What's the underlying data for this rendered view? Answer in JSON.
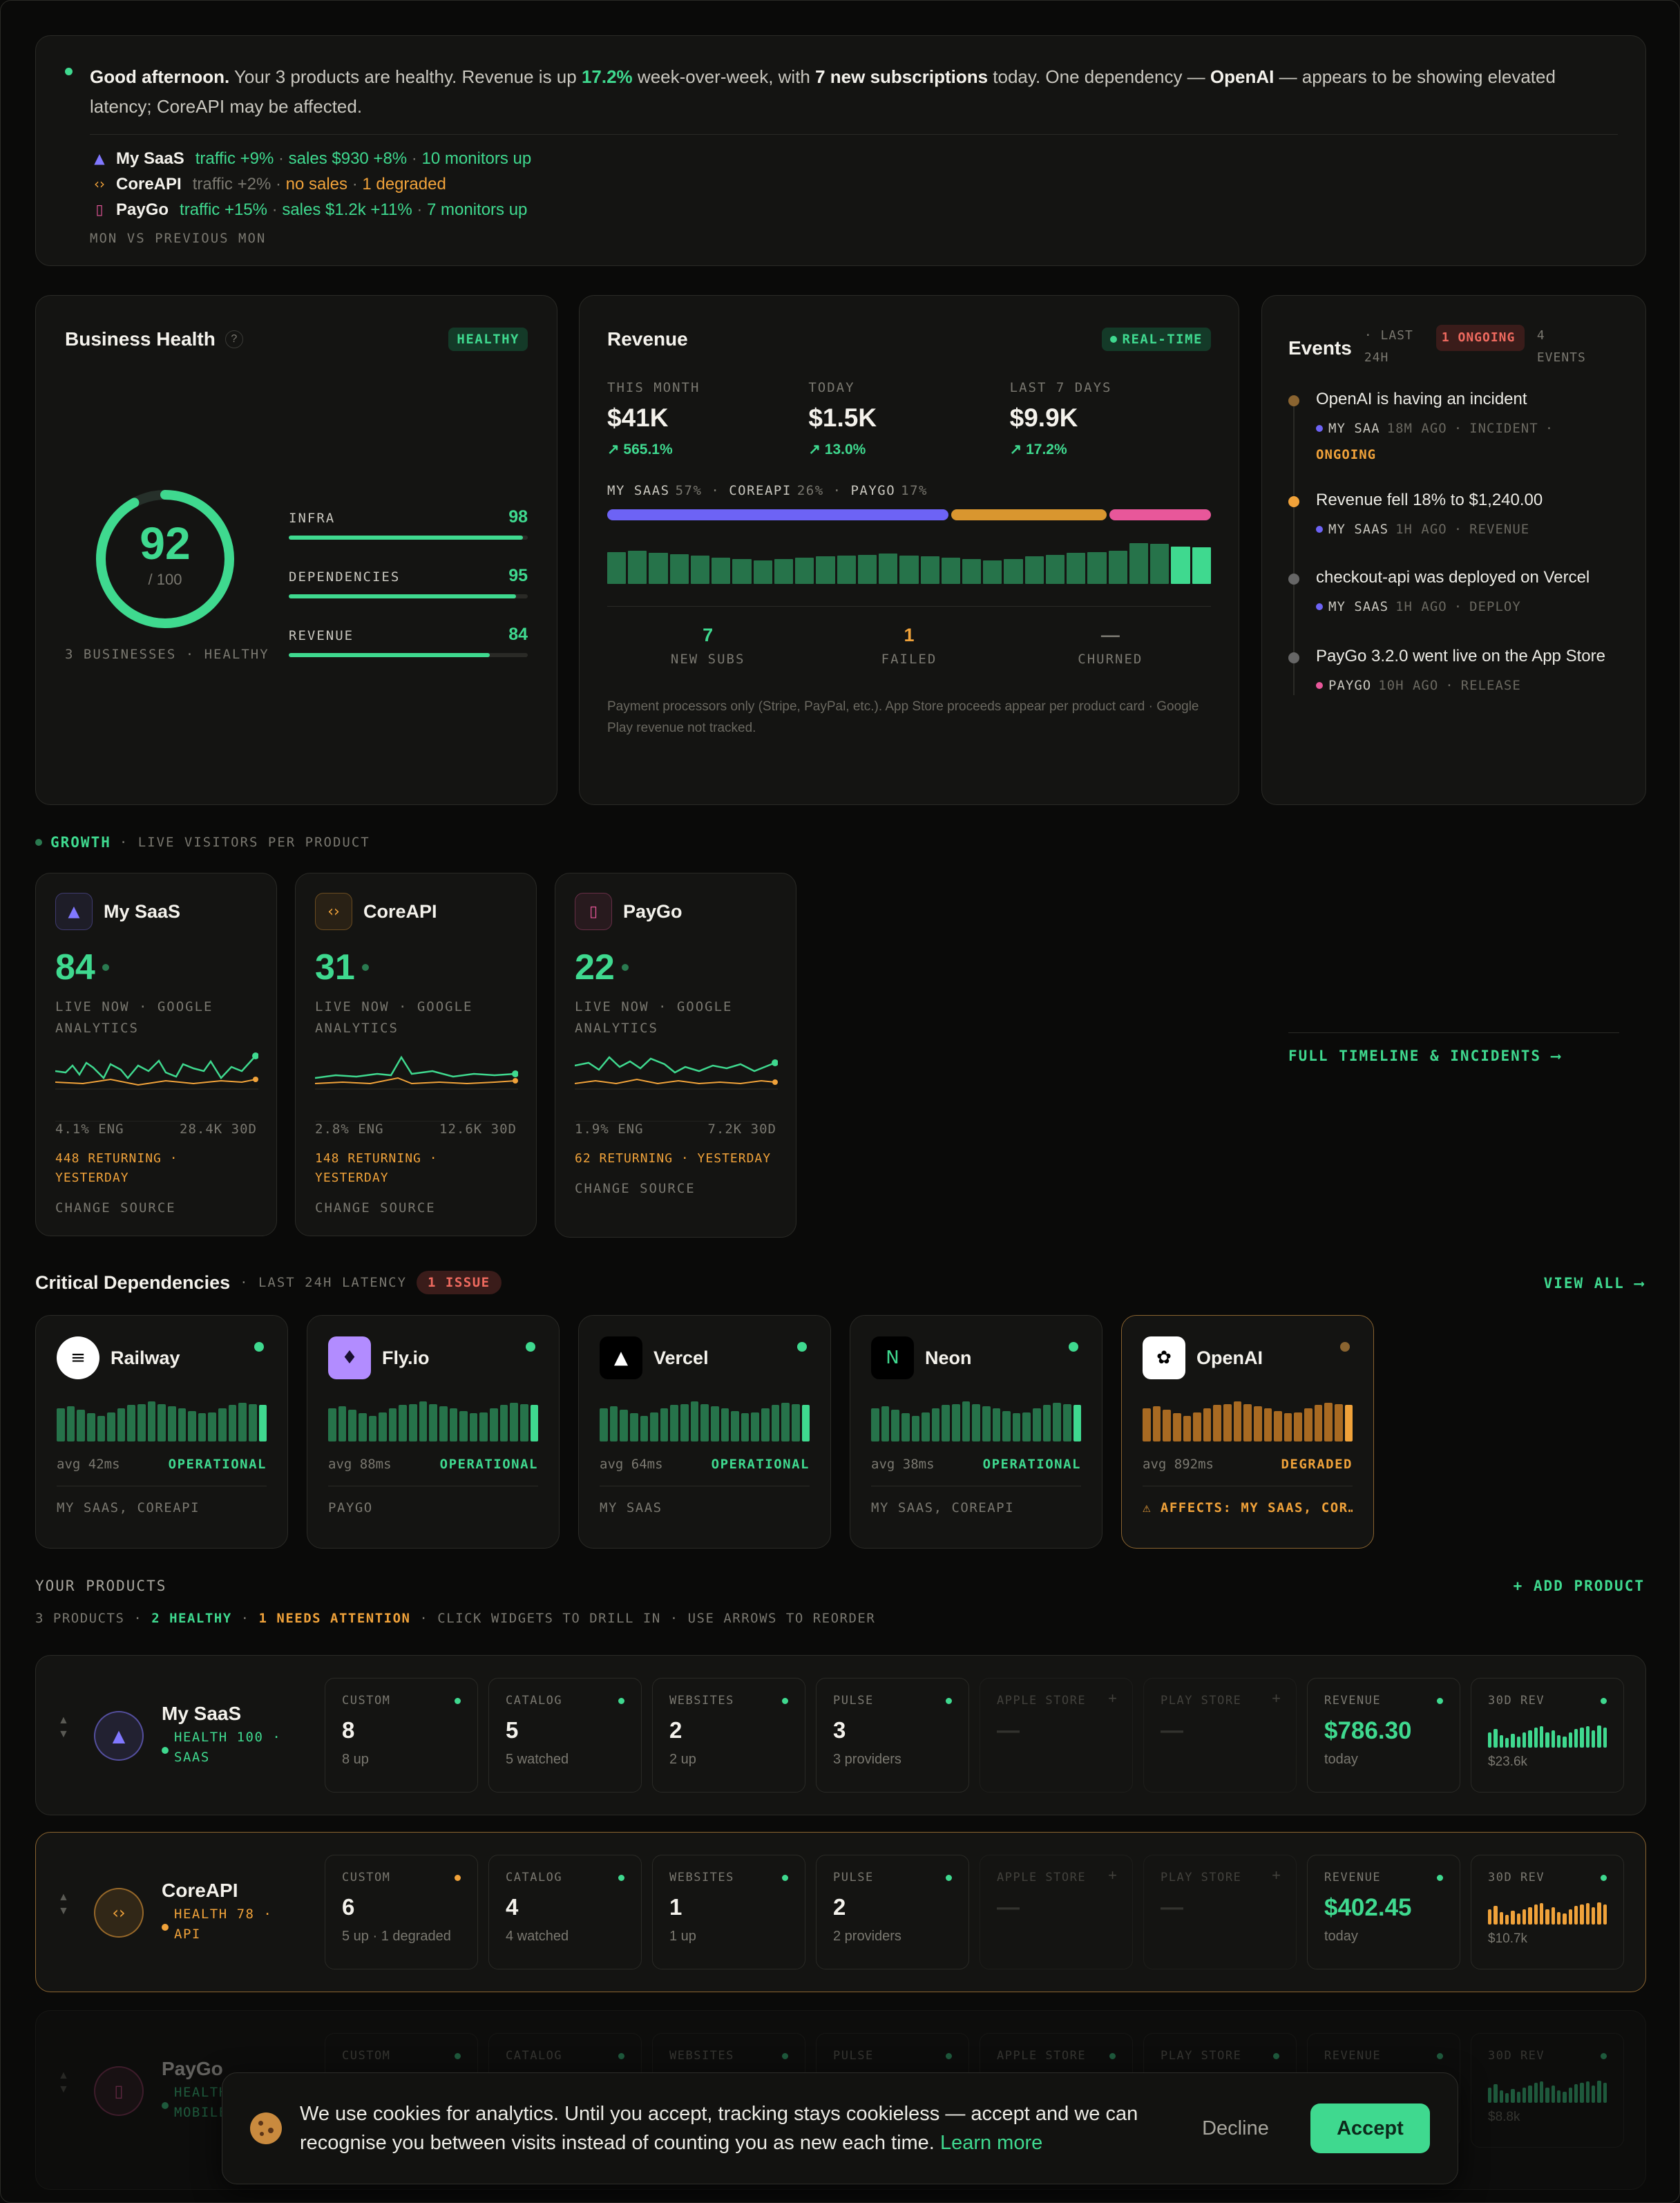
{
  "summary": {
    "greeting": "Good afternoon.",
    "t1": " Your 3 products are healthy. Revenue is up ",
    "pct": "17.2%",
    "t2": " week-over-week, with ",
    "subs": "7 new subscriptions",
    "t3": " today. One dependency — ",
    "dep": "OpenAI",
    "t4": " — appears to be showing elevated latency; CoreAPI may be affected.",
    "lines": [
      {
        "name": "My SaaS",
        "parts": [
          {
            "t": "traffic +9%",
            "c": "green"
          },
          {
            "t": " · ",
            "c": "muted"
          },
          {
            "t": "sales $930 +8%",
            "c": "green"
          },
          {
            "t": " · ",
            "c": "muted"
          },
          {
            "t": "10 monitors up",
            "c": "green"
          }
        ],
        "icon": "rocket-icon",
        "color": "#8178ff"
      },
      {
        "name": "CoreAPI",
        "parts": [
          {
            "t": "traffic +2%",
            "c": "muted"
          },
          {
            "t": " · ",
            "c": "muted"
          },
          {
            "t": "no sales",
            "c": "orange"
          },
          {
            "t": " · ",
            "c": "muted"
          },
          {
            "t": "1 degraded",
            "c": "orange"
          }
        ],
        "icon": "code-icon",
        "color": "#f0a23a"
      },
      {
        "name": "PayGo",
        "parts": [
          {
            "t": "traffic +15%",
            "c": "green"
          },
          {
            "t": " · ",
            "c": "muted"
          },
          {
            "t": "sales $1.2k +11%",
            "c": "green"
          },
          {
            "t": " · ",
            "c": "muted"
          },
          {
            "t": "7 monitors up",
            "c": "green"
          }
        ],
        "icon": "phone-icon",
        "color": "#e8579a"
      }
    ],
    "footer": "MON VS PREVIOUS MON"
  },
  "health": {
    "title": "Business Health",
    "badge": "HEALTHY",
    "score": "92",
    "score_value": 92,
    "of": "/ 100",
    "caption": "3 BUSINESSES · HEALTHY",
    "metrics": [
      {
        "label": "INFRA",
        "value": "98",
        "pct": 98
      },
      {
        "label": "DEPENDENCIES",
        "value": "95",
        "pct": 95
      },
      {
        "label": "REVENUE",
        "value": "84",
        "pct": 84
      }
    ]
  },
  "revenue": {
    "title": "Revenue",
    "badge": "REAL-TIME",
    "kpis": [
      {
        "label": "THIS MONTH",
        "value": "$41K",
        "delta": "↗ 565.1%"
      },
      {
        "label": "TODAY",
        "value": "$1.5K",
        "delta": "↗ 13.0%"
      },
      {
        "label": "LAST 7 DAYS",
        "value": "$9.9K",
        "delta": "↗ 17.2%"
      }
    ],
    "split": [
      {
        "name": "MY SAAS",
        "pct": "57%",
        "share": 57,
        "color": "#6d63f5"
      },
      {
        "name": "COREAPI",
        "pct": "26%",
        "share": 26,
        "color": "#d9962f"
      },
      {
        "name": "PAYGO",
        "pct": "17%",
        "share": 17,
        "color": "#e8579a"
      }
    ],
    "bars": [
      0.7,
      0.72,
      0.68,
      0.65,
      0.62,
      0.58,
      0.55,
      0.52,
      0.55,
      0.58,
      0.6,
      0.62,
      0.64,
      0.66,
      0.62,
      0.6,
      0.58,
      0.55,
      0.52,
      0.55,
      0.6,
      0.64,
      0.68,
      0.7,
      0.72,
      0.9,
      0.88,
      0.82,
      0.8
    ],
    "stats": [
      {
        "value": "7",
        "label": "NEW SUBS",
        "c": "green"
      },
      {
        "value": "1",
        "label": "FAILED",
        "c": "orange"
      },
      {
        "value": "—",
        "label": "CHURNED",
        "c": "muted"
      }
    ],
    "note": "Payment processors only (Stripe, PayPal, etc.). App Store proceeds appear per product card · Google Play revenue not tracked."
  },
  "events": {
    "title": "Events",
    "range": "· LAST 24H",
    "ongoing": "1 ONGOING",
    "count": "4 EVENTS",
    "items": [
      {
        "title": "OpenAI is having an incident",
        "dot": "#8a6430",
        "prod": "MY SAA",
        "pcolor": "#6d63f5",
        "meta": "18M AGO",
        "kind": "INCIDENT",
        "extra": "ONGOING"
      },
      {
        "title": "Revenue fell 18% to $1,240.00",
        "dot": "#f0a23a",
        "prod": "MY SAAS",
        "pcolor": "#6d63f5",
        "meta": "1H AGO",
        "kind": "REVENUE",
        "extra": ""
      },
      {
        "title": "checkout-api was deployed on Vercel",
        "dot": "#666",
        "prod": "MY SAAS",
        "pcolor": "#6d63f5",
        "meta": "1H AGO",
        "kind": "DEPLOY",
        "extra": ""
      },
      {
        "title": "PayGo 3.2.0 went live on the App Store",
        "dot": "#666",
        "prod": "PAYGO",
        "pcolor": "#e8579a",
        "meta": "10H AGO",
        "kind": "RELEASE",
        "extra": ""
      }
    ],
    "link": "FULL TIMELINE & INCIDENTS ⟶"
  },
  "growth": {
    "title": "GROWTH",
    "sub": "· LIVE VISITORS PER PRODUCT",
    "cards": [
      {
        "name": "My SaaS",
        "icon": "rocket-icon",
        "color": "#8178ff",
        "live": "84",
        "src1": "LIVE NOW · GOOGLE",
        "src2": "ANALYTICS",
        "eng": "4.1% ENG",
        "vis": "28.4K 30D",
        "ret1": "448 RETURNING ·",
        "ret2": "YESTERDAY",
        "change": "CHANGE SOURCE"
      },
      {
        "name": "CoreAPI",
        "icon": "code-icon",
        "color": "#f0a23a",
        "live": "31",
        "src1": "LIVE NOW · GOOGLE",
        "src2": "ANALYTICS",
        "eng": "2.8% ENG",
        "vis": "12.6K 30D",
        "ret1": "148 RETURNING ·",
        "ret2": "YESTERDAY",
        "change": "CHANGE SOURCE"
      },
      {
        "name": "PayGo",
        "icon": "phone-icon",
        "color": "#e8579a",
        "live": "22",
        "src1": "LIVE NOW · GOOGLE",
        "src2": "ANALYTICS",
        "eng": "1.9% ENG",
        "vis": "7.2K 30D",
        "ret1": "62 RETURNING · YESTERDAY",
        "ret2": "",
        "change": "CHANGE SOURCE"
      }
    ]
  },
  "deps": {
    "title": "Critical Dependencies",
    "sub": "· LAST 24H LATENCY",
    "issue": "1 ISSUE",
    "view": "VIEW ALL ⟶",
    "items": [
      {
        "name": "Railway",
        "avg": "avg 42ms",
        "status": "OPERATIONAL",
        "used": "MY SAAS, COREAPI",
        "icon": "railway-icon",
        "ok": true
      },
      {
        "name": "Fly.io",
        "avg": "avg 88ms",
        "status": "OPERATIONAL",
        "used": "PAYGO",
        "icon": "balloon-icon",
        "ok": true
      },
      {
        "name": "Vercel",
        "avg": "avg 64ms",
        "status": "OPERATIONAL",
        "used": "MY SAAS",
        "icon": "triangle-icon",
        "ok": true
      },
      {
        "name": "Neon",
        "avg": "avg 38ms",
        "status": "OPERATIONAL",
        "used": "MY SAAS, COREAPI",
        "icon": "neon-icon",
        "ok": true
      },
      {
        "name": "OpenAI",
        "avg": "avg 892ms",
        "status": "DEGRADED",
        "used": "⚠ AFFECTS: MY SAAS, COR…",
        "icon": "openai-icon",
        "ok": false
      }
    ]
  },
  "products": {
    "title": "YOUR PRODUCTS",
    "add": "+ ADD PRODUCT",
    "summary": [
      {
        "t": "3 PRODUCTS",
        "c": "muted"
      },
      {
        "t": " · ",
        "c": "muted"
      },
      {
        "t": "2 HEALTHY",
        "c": "green"
      },
      {
        "t": " · ",
        "c": "muted"
      },
      {
        "t": "1 NEEDS ATTENTION",
        "c": "orange"
      },
      {
        "t": " · CLICK WIDGETS TO DRILL IN · USE ARROWS TO REORDER",
        "c": "muted"
      }
    ],
    "rows": [
      {
        "name": "My SaaS",
        "h1": "HEALTH 100 ·",
        "h2": "SAAS",
        "color": "#8178ff",
        "hc": "green",
        "icon": "rocket-icon",
        "border": "#2a2a26",
        "tiles": [
          {
            "l": "CUSTOM",
            "v": "8",
            "s": "8 up",
            "dot": "#3fd98f"
          },
          {
            "l": "CATALOG",
            "v": "5",
            "s": "5 watched",
            "dot": "#3fd98f"
          },
          {
            "l": "WEBSITES",
            "v": "2",
            "s": "2 up",
            "dot": "#3fd98f"
          },
          {
            "l": "PULSE",
            "v": "3",
            "s": "3 providers",
            "dot": "#3fd98f"
          },
          {
            "l": "APPLE STORE",
            "v": "—",
            "s": "",
            "dot": "+"
          },
          {
            "l": "PLAY STORE",
            "v": "—",
            "s": "",
            "dot": "+"
          }
        ],
        "rev": "$786.30",
        "rev_s": "today",
        "r30": "$23.6k",
        "r30color": "#3fd98f"
      },
      {
        "name": "CoreAPI",
        "h1": "HEALTH 78 ·",
        "h2": "API",
        "color": "#f0a23a",
        "hc": "orange",
        "icon": "code-icon",
        "border": "#8a6430",
        "tiles": [
          {
            "l": "CUSTOM",
            "v": "6",
            "s": "5 up · 1 degraded",
            "dot": "#f0a23a"
          },
          {
            "l": "CATALOG",
            "v": "4",
            "s": "4 watched",
            "dot": "#3fd98f"
          },
          {
            "l": "WEBSITES",
            "v": "1",
            "s": "1 up",
            "dot": "#3fd98f"
          },
          {
            "l": "PULSE",
            "v": "2",
            "s": "2 providers",
            "dot": "#3fd98f"
          },
          {
            "l": "APPLE STORE",
            "v": "—",
            "s": "",
            "dot": "+"
          },
          {
            "l": "PLAY STORE",
            "v": "—",
            "s": "",
            "dot": "+"
          }
        ],
        "rev": "$402.45",
        "rev_s": "today",
        "r30": "$10.7k",
        "r30color": "#f0a23a"
      },
      {
        "name": "PayGo",
        "h1": "HEALTH",
        "h2": "MOBILE",
        "color": "#e8579a",
        "hc": "green",
        "icon": "phone-icon",
        "border": "#2a2a26",
        "tiles": [
          {
            "l": "CUSTOM",
            "v": "",
            "s": "",
            "dot": "#3fd98f"
          },
          {
            "l": "CATALOG",
            "v": "",
            "s": "",
            "dot": "#3fd98f"
          },
          {
            "l": "WEBSITES",
            "v": "",
            "s": "",
            "dot": "#3fd98f"
          },
          {
            "l": "PULSE",
            "v": "",
            "s": "",
            "dot": "#3fd98f"
          },
          {
            "l": "APPLE STORE",
            "v": "",
            "s": "",
            "dot": "#3fd98f"
          },
          {
            "l": "PLAY STORE",
            "v": "",
            "s": "",
            "dot": "#3fd98f"
          }
        ],
        "rev": "",
        "rev_s": "",
        "r30": "$8.8k",
        "r30color": "#3fd98f"
      }
    ]
  },
  "cookie": {
    "text": "We use cookies for analytics. Until you accept, tracking stays cookieless — accept and we can recognise you between visits instead of counting you as new each time.",
    "link": "Learn more",
    "decline": "Decline",
    "accept": "Accept"
  }
}
